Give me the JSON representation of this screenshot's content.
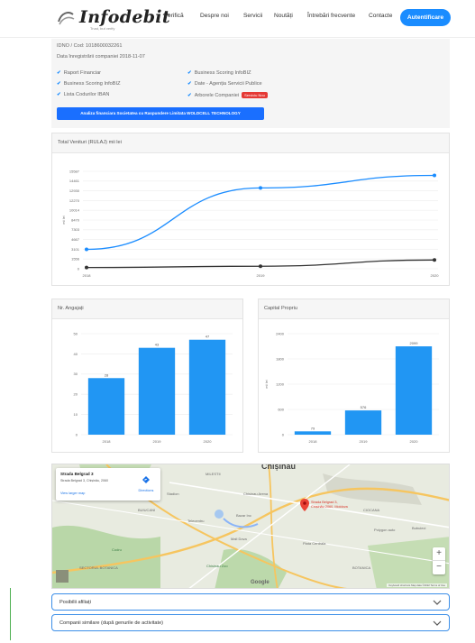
{
  "header": {
    "logo_text": "Infodebit",
    "logo_tagline": "Trust, but verify",
    "nav": [
      "Verifică",
      "Despre noi",
      "Servicii",
      "Noutăți",
      "Întrebări frecvente",
      "Contacte"
    ],
    "auth_button": "Autentificare",
    "accent_color": "#1a8cff"
  },
  "company": {
    "idno": "IDNO / Cod: 1018600032261",
    "registration": "Data înregistrării companiei 2018-11-07",
    "features_left": [
      "Raport Financiar",
      "Business Scoring InfoBIZ",
      "Lista Codurilor IBAN"
    ],
    "features_right": [
      "Business Scoring InfoBIZ",
      "Date - Agenția Servicii Publice",
      "Arborele Companiei"
    ],
    "new_badge": "Serviciu Nou",
    "analysis_button": "Analiza financiara Societatea cu Raspundere Limitata WOLDCELL TECHNOLOGY"
  },
  "chart_sales": {
    "title": "Total Venituri (RULAJ) mii lei",
    "chart_data": {
      "type": "line",
      "title": "Total Venituri (RULAJ) mii lei",
      "x": [
        "2018",
        "2019",
        "2020"
      ],
      "series": [
        {
          "name": "",
          "values": [
            3101,
            12931,
            14940
          ],
          "color": "#1a8cff"
        },
        {
          "name": "",
          "values": [
            200,
            400,
            1400
          ],
          "color": "#333333"
        }
      ],
      "ylabel": "mii lei",
      "yticks": [
        "0",
        "1556",
        "3101",
        "4667",
        "7303",
        "8470",
        "10014",
        "12270",
        "12930",
        "14461",
        "15587"
      ],
      "ylim": [
        0,
        15587
      ],
      "grid": true
    }
  },
  "chart_employees": {
    "title": "Nr. Angajați",
    "chart_data": {
      "type": "bar",
      "categories": [
        "2018",
        "2019",
        "2020"
      ],
      "values": [
        28,
        43,
        47
      ],
      "yticks": [
        "0",
        "10",
        "20",
        "30",
        "40",
        "50"
      ],
      "ylim": [
        0,
        50
      ],
      "color": "#2196f3",
      "grid": true
    }
  },
  "chart_equity": {
    "title": "Capital Propriu",
    "chart_data": {
      "type": "bar",
      "categories": [
        "2018",
        "2019",
        "2020"
      ],
      "values": [
        79,
        576,
        2099
      ],
      "ylabel": "mii lei",
      "yticks": [
        "0",
        "600",
        "1200",
        "1800",
        "2400"
      ],
      "ylim": [
        0,
        2400
      ],
      "color": "#2196f3",
      "grid": true
    }
  },
  "map": {
    "popup_title": "Strada Belgrad 3",
    "popup_address": "Strada Belgrad 3, Chișinău, 2060",
    "directions": "Directions",
    "view_larger": "View larger map",
    "pin_label": "Strada Belgrad 3,\nChișinău 2060, Moldova",
    "city": "Chișinău",
    "labels": [
      "MILESTII",
      "Bubuieci",
      "Codru",
      "CIOCANA",
      "BOTANICA",
      "BUIUCANI",
      "Telecentru",
      "Chisinau Zoo",
      "Polygon auto",
      "Bazar Inc",
      "Piata Centrala",
      "Mall Dova",
      "SECTORUL BOTANICA",
      "Chisinau Arena",
      "Stadion"
    ],
    "footer": "Keyboard shortcuts   Map data ©2022   Terms of Use",
    "google": "Google"
  },
  "accordion": [
    {
      "label": "Posibilii afiliați"
    },
    {
      "label": "Companii similare (după genurile de activitate)"
    }
  ]
}
